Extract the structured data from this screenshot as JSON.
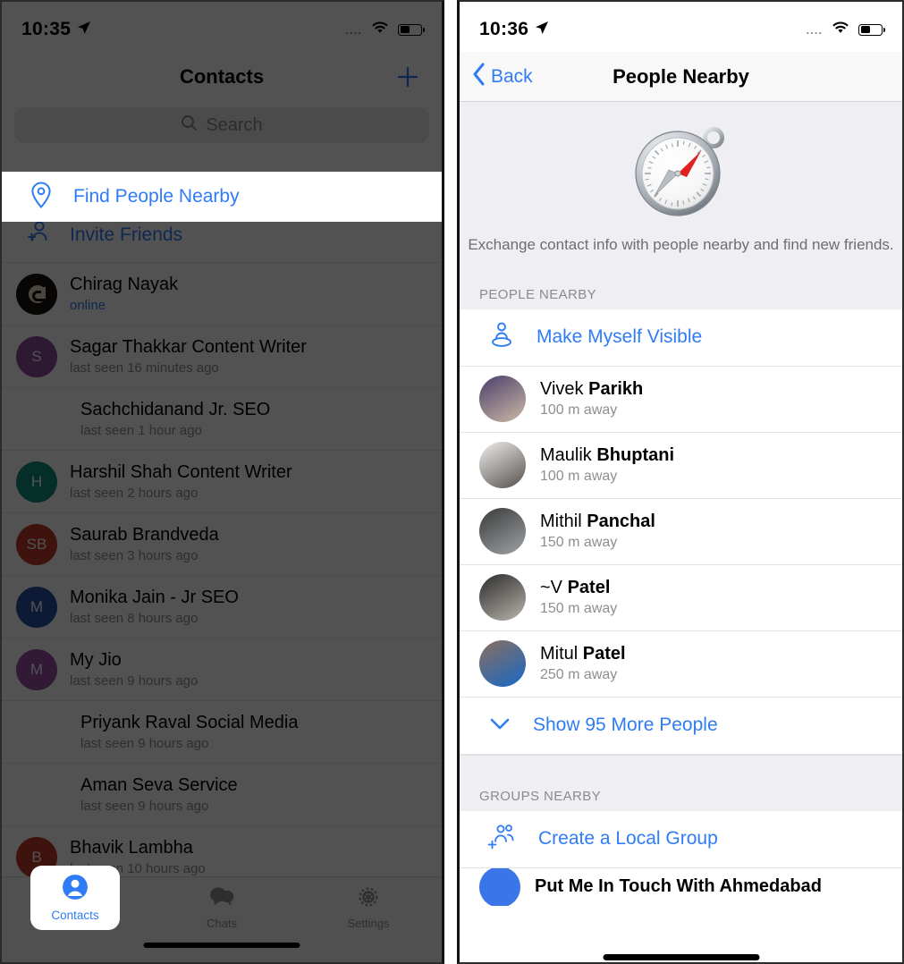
{
  "left_phone": {
    "status_bar": {
      "time": "10:35",
      "location_icon": "location-arrow-icon",
      "signal_dots": "....",
      "wifi_icon": "wifi-icon",
      "battery_icon": "battery-icon"
    },
    "nav": {
      "title": "Contacts",
      "add_label": "+"
    },
    "search": {
      "placeholder": "Search",
      "icon": "search-icon"
    },
    "spotlight": {
      "label": "Find People Nearby",
      "icon": "map-pin-icon"
    },
    "invite": {
      "label": "Invite Friends",
      "icon": "person-add-icon"
    },
    "contacts": [
      {
        "avatar_type": "image",
        "avatar_color": "#16140f",
        "initials": "C",
        "name": "Chirag Nayak",
        "status": "online",
        "online": true
      },
      {
        "avatar_type": "initials",
        "avatar_color": "#8e4fa0",
        "initials": "S",
        "name": "Sagar Thakkar Content Writer",
        "status": "last seen 16 minutes ago",
        "online": false
      },
      {
        "avatar_type": "none",
        "avatar_color": "",
        "initials": "",
        "name": "Sachchidanand Jr. SEO",
        "status": "last seen 1 hour ago",
        "online": false
      },
      {
        "avatar_type": "initials",
        "avatar_color": "#15907f",
        "initials": "H",
        "name": "Harshil Shah Content Writer",
        "status": "last seen 2 hours ago",
        "online": false
      },
      {
        "avatar_type": "initials",
        "avatar_color": "#c0392b",
        "initials": "SB",
        "name": "Saurab Brandveda",
        "status": "last seen 3 hours ago",
        "online": false
      },
      {
        "avatar_type": "initials",
        "avatar_color": "#2a53a8",
        "initials": "M",
        "name": "Monika Jain - Jr SEO",
        "status": "last seen 8 hours ago",
        "online": false
      },
      {
        "avatar_type": "initials",
        "avatar_color": "#9b4fa8",
        "initials": "M",
        "name": "My Jio",
        "status": "last seen 9 hours ago",
        "online": false
      },
      {
        "avatar_type": "none",
        "avatar_color": "",
        "initials": "",
        "name": "Priyank Raval Social Media",
        "status": "last seen 9 hours ago",
        "online": false
      },
      {
        "avatar_type": "none",
        "avatar_color": "",
        "initials": "",
        "name": "Aman Seva Service",
        "status": "last seen 9 hours ago",
        "online": false
      },
      {
        "avatar_type": "initials",
        "avatar_color": "#c0392b",
        "initials": "B",
        "name": "Bhavik Lambha",
        "status": "last seen 10 hours ago",
        "online": false
      }
    ],
    "tabs": [
      {
        "label": "Contacts",
        "icon": "person-circle-icon",
        "active": true
      },
      {
        "label": "Chats",
        "icon": "chat-bubbles-icon",
        "active": false
      },
      {
        "label": "Settings",
        "icon": "gear-icon",
        "active": false
      }
    ]
  },
  "right_phone": {
    "status_bar": {
      "time": "10:36",
      "location_icon": "location-arrow-icon",
      "signal_dots": "....",
      "wifi_icon": "wifi-icon",
      "battery_icon": "battery-icon"
    },
    "nav": {
      "back_label": "Back",
      "back_icon": "chevron-left-icon",
      "title": "People Nearby"
    },
    "hero": {
      "illustration": "compass-icon",
      "description": "Exchange contact info with people nearby and find new friends."
    },
    "people_section": {
      "header": "PEOPLE NEARBY",
      "make_visible": {
        "label": "Make Myself Visible",
        "icon": "person-location-icon"
      },
      "people": [
        {
          "first": "Vivek ",
          "last": "Parikh",
          "distance": "100 m away",
          "avatar": "photo-vivek",
          "c1": "#4a3f6b",
          "c2": "#cdb9a6"
        },
        {
          "first": "Maulik ",
          "last": "Bhuptani",
          "distance": "100 m away",
          "avatar": "photo-maulik",
          "c1": "#efeeec",
          "c2": "#56504c"
        },
        {
          "first": "Mithil ",
          "last": "Panchal",
          "distance": "150 m away",
          "avatar": "photo-mithil",
          "c1": "#3a3a3a",
          "c2": "#9fa3a6"
        },
        {
          "first": "~V ",
          "last": "Patel",
          "distance": "150 m away",
          "avatar": "photo-v-patel",
          "c1": "#2c2c2c",
          "c2": "#b9b4ac"
        },
        {
          "first": "Mitul ",
          "last": "Patel",
          "distance": "250 m away",
          "avatar": "photo-mitul",
          "c1": "#8c6f5e",
          "c2": "#1668c6"
        }
      ],
      "show_more": {
        "label": "Show 95 More People",
        "icon": "chevron-down-icon"
      }
    },
    "groups_section": {
      "header": "GROUPS NEARBY",
      "create_group": {
        "label": "Create a Local Group",
        "icon": "group-add-icon"
      },
      "first_group": {
        "name": "Put Me In Touch With Ahmedabad",
        "avatar_color": "#3b76e8"
      }
    }
  },
  "theme": {
    "accent_blue": "#2f7cf6",
    "scrim": "rgba(0,0,0,0.68)",
    "ios_gray_bg": "#eeeef3",
    "secondary_text": "#8e8e93"
  }
}
